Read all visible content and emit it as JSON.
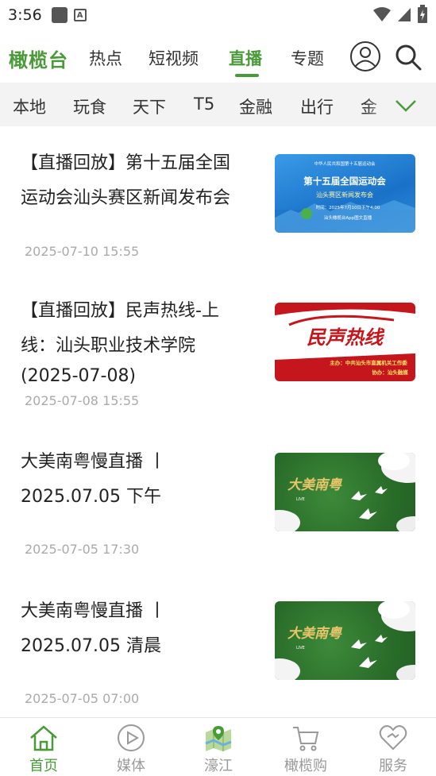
{
  "status_bar": {
    "time": "3:56"
  },
  "header": {
    "brand": "橄榄台",
    "tabs": [
      {
        "label": "热点",
        "active": false
      },
      {
        "label": "短视频",
        "active": false
      },
      {
        "label": "直播",
        "active": true
      },
      {
        "label": "专题",
        "active": false
      }
    ],
    "icons": [
      "user-icon",
      "search-icon"
    ]
  },
  "categories": [
    "本地",
    "玩食",
    "天下",
    "T5",
    "金融",
    "出行",
    "金"
  ],
  "feed": [
    {
      "title_line1": "【直播回放】第十五届全国",
      "title_line2": "运动会汕头赛区新闻发布会",
      "title_line3": "",
      "date": "2025-07-10 15:55",
      "thumb": {
        "top_text": "中华人民共和国第十五届运动会",
        "main_text": "第十五届全国运动会",
        "sub_text": "汕头赛区新闻发布会",
        "time_text": "时间：2025年7月10日下午4:00",
        "foot_text": "汕头橄榄台App图文直播"
      }
    },
    {
      "title_line1": "【直播回放】民声热线-上",
      "title_line2": "线：汕头职业技术学院",
      "title_line3": "(2025-07-08)",
      "date": "2025-07-08 15:55",
      "thumb": {
        "main_text": "民声热线",
        "host_text": "主办：中共汕头市直属机关工作委",
        "co_text": "协办：汕头融媒"
      }
    },
    {
      "title_line1": "大美南粤慢直播 丨",
      "title_line2": "2025.07.05 下午",
      "title_line3": "",
      "date": "2025-07-05 17:30",
      "thumb": {
        "main_text": "大美南粤",
        "live_text": "LIVE"
      }
    },
    {
      "title_line1": "大美南粤慢直播 丨",
      "title_line2": "2025.07.05 清晨",
      "title_line3": "",
      "date": "2025-07-05 07:00",
      "thumb": {
        "main_text": "大美南粤",
        "live_text": "LIVE"
      }
    }
  ],
  "bottom_nav": [
    {
      "label": "首页",
      "icon": "home-icon",
      "active": true
    },
    {
      "label": "媒体",
      "icon": "play-circle-icon",
      "active": false
    },
    {
      "label": "濠江",
      "icon": "map-icon",
      "active": false
    },
    {
      "label": "橄榄购",
      "icon": "cart-icon",
      "active": false
    },
    {
      "label": "服务",
      "icon": "heart-icon",
      "active": false
    }
  ],
  "colors": {
    "accent": "#4a9a3a",
    "muted": "#aaaaaa",
    "category_bg": "#f3f3f3"
  }
}
